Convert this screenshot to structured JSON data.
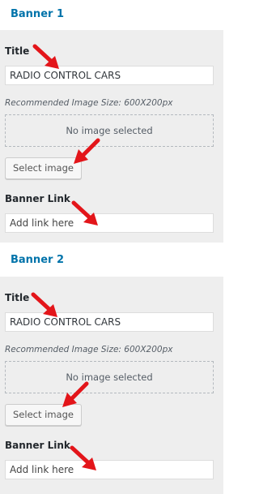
{
  "banners": [
    {
      "heading": "Banner 1",
      "title_label": "Title",
      "title_value": "RADIO CONTROL CARS",
      "image_hint": "Recommended Image Size: 600X200px",
      "no_image_text": "No image selected",
      "select_image_label": "Select image",
      "link_label": "Banner Link",
      "link_placeholder": "Add link here"
    },
    {
      "heading": "Banner 2",
      "title_label": "Title",
      "title_value": "RADIO CONTROL CARS",
      "image_hint": "Recommended Image Size: 600X200px",
      "no_image_text": "No image selected",
      "select_image_label": "Select image",
      "link_label": "Banner Link",
      "link_placeholder": "Add link here"
    }
  ],
  "colors": {
    "heading": "#0073aa",
    "panel_bg": "#eeeeee",
    "annotation_arrow": "#e3151a"
  },
  "annotations": {
    "arrow_icon": "red-arrow-icon"
  }
}
